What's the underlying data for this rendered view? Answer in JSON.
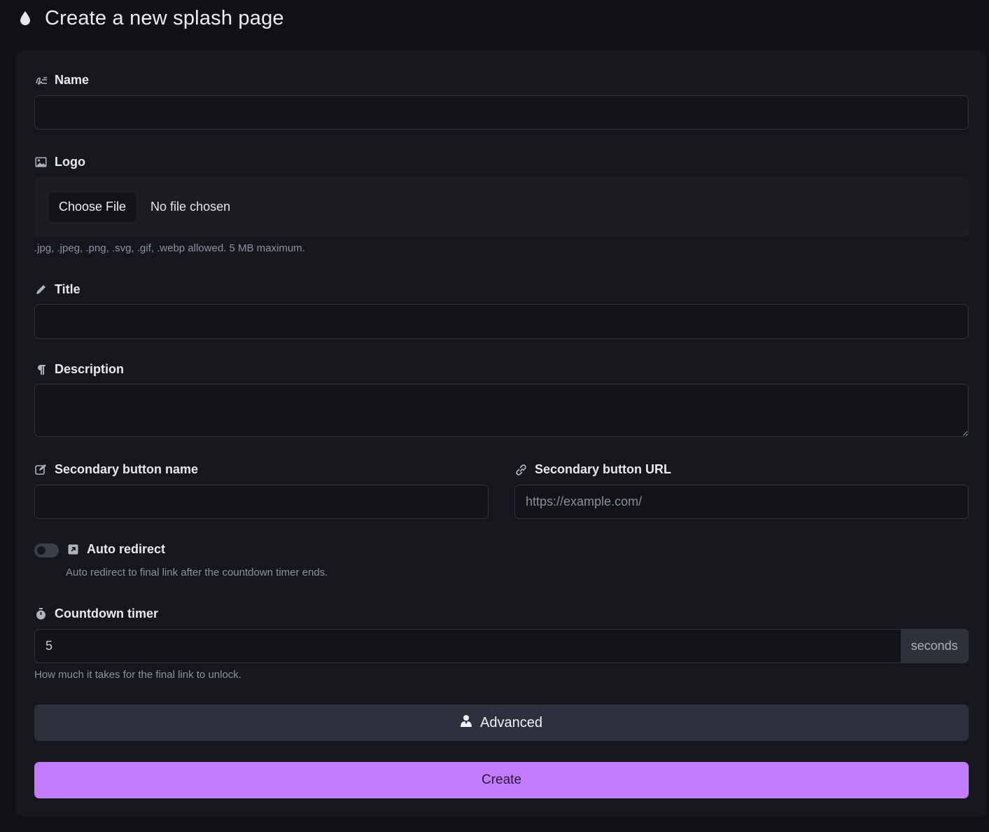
{
  "header": {
    "title": "Create a new splash page",
    "icon": "droplet-icon"
  },
  "form": {
    "name": {
      "label": "Name",
      "icon": "signature-icon",
      "value": "",
      "placeholder": ""
    },
    "logo": {
      "label": "Logo",
      "icon": "image-icon",
      "choose_file_label": "Choose File",
      "file_status": "No file chosen",
      "help": ".jpg, .jpeg, .png, .svg, .gif, .webp allowed. 5 MB maximum."
    },
    "title": {
      "label": "Title",
      "icon": "pencil-icon",
      "value": "",
      "placeholder": ""
    },
    "description": {
      "label": "Description",
      "icon": "paragraph-icon",
      "value": "",
      "placeholder": ""
    },
    "secondary_button_name": {
      "label": "Secondary button name",
      "icon": "edit-icon",
      "value": "",
      "placeholder": ""
    },
    "secondary_button_url": {
      "label": "Secondary button URL",
      "icon": "link-icon",
      "value": "",
      "placeholder": "https://example.com/"
    },
    "auto_redirect": {
      "label": "Auto redirect",
      "icon": "external-link-icon",
      "enabled": false,
      "help": "Auto redirect to final link after the countdown timer ends."
    },
    "countdown_timer": {
      "label": "Countdown timer",
      "icon": "stopwatch-icon",
      "value": "5",
      "unit": "seconds",
      "help": "How much it takes for the final link to unlock."
    },
    "advanced_label": "Advanced",
    "advanced_icon": "user-tie-icon",
    "create_label": "Create"
  },
  "colors": {
    "accent": "#c27bfb",
    "background": "#0f1115",
    "card": "#15171c"
  }
}
